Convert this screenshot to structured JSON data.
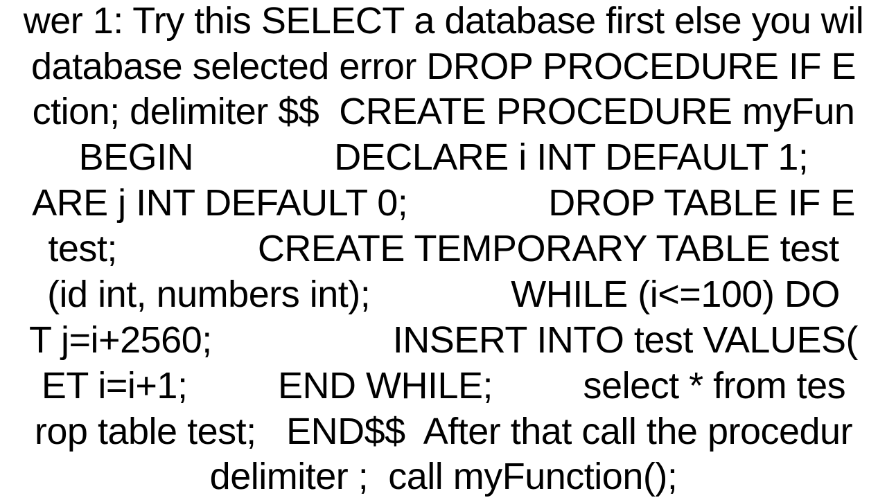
{
  "text": "wer 1: Try this SELECT a database first else you wil\ndatabase selected error DROP PROCEDURE IF E\nction; delimiter $$  CREATE PROCEDURE myFun\nBEGIN              DECLARE i INT DEFAULT 1;\nARE j INT DEFAULT 0;              DROP TABLE IF E\ntest;              CREATE TEMPORARY TABLE test\n(id int, numbers int);              WHILE (i<=100) DO\nT j=i+2560;                  INSERT INTO test VALUES(\nET i=i+1;         END WHILE;         select * from tes\nrop table test;   END$$  After that call the procedur\ndelimiter ;  call myFunction();"
}
